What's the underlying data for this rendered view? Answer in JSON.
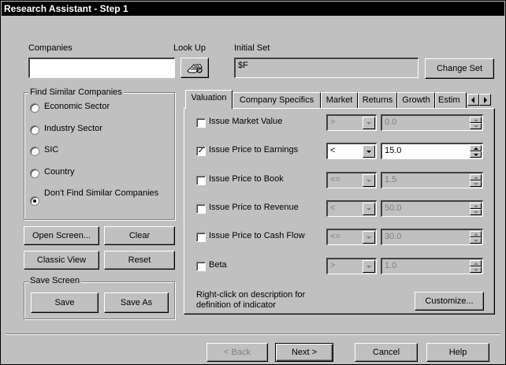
{
  "window": {
    "title": "Research Assistant - Step 1"
  },
  "top": {
    "companies_label": "Companies",
    "companies_value": "",
    "lookup_label": "Look Up",
    "initial_set_label": "Initial Set",
    "initial_set_value": "$F",
    "change_set_button": "Change Set"
  },
  "find_similar": {
    "title": "Find Similar Companies",
    "options": [
      {
        "label": "Economic Sector",
        "selected": false
      },
      {
        "label": "Industry Sector",
        "selected": false
      },
      {
        "label": "SIC",
        "selected": false
      },
      {
        "label": "Country",
        "selected": false
      },
      {
        "label": "Don't Find Similar Companies",
        "selected": true
      }
    ]
  },
  "screen_buttons": {
    "open_screen": "Open Screen...",
    "clear": "Clear",
    "classic_view": "Classic View",
    "reset": "Reset"
  },
  "save_screen": {
    "title": "Save Screen",
    "save": "Save",
    "save_as": "Save As"
  },
  "tabs": [
    "Valuation",
    "Company Specifics",
    "Market",
    "Returns",
    "Growth",
    "Estim"
  ],
  "active_tab": "Valuation",
  "criteria": [
    {
      "label": "Issue Market Value",
      "checked": false,
      "operator": ">",
      "value": "0.0"
    },
    {
      "label": "Issue Price to Earnings",
      "checked": true,
      "operator": "<",
      "value": "15.0"
    },
    {
      "label": "Issue Price to Book",
      "checked": false,
      "operator": "<=",
      "value": "1.5"
    },
    {
      "label": "Issue Price to Revenue",
      "checked": false,
      "operator": "<",
      "value": "50.0"
    },
    {
      "label": "Issue Price to Cash Flow",
      "checked": false,
      "operator": "<=",
      "value": "30.0"
    },
    {
      "label": "Beta",
      "checked": false,
      "operator": ">",
      "value": "1.0"
    }
  ],
  "hint": {
    "line1": "Right-click on description for",
    "line2": "definition of indicator"
  },
  "customize_button": "Customize...",
  "footer": {
    "back": "< Back",
    "next": "Next >",
    "cancel": "Cancel",
    "help": "Help"
  },
  "checkmark": "✓"
}
